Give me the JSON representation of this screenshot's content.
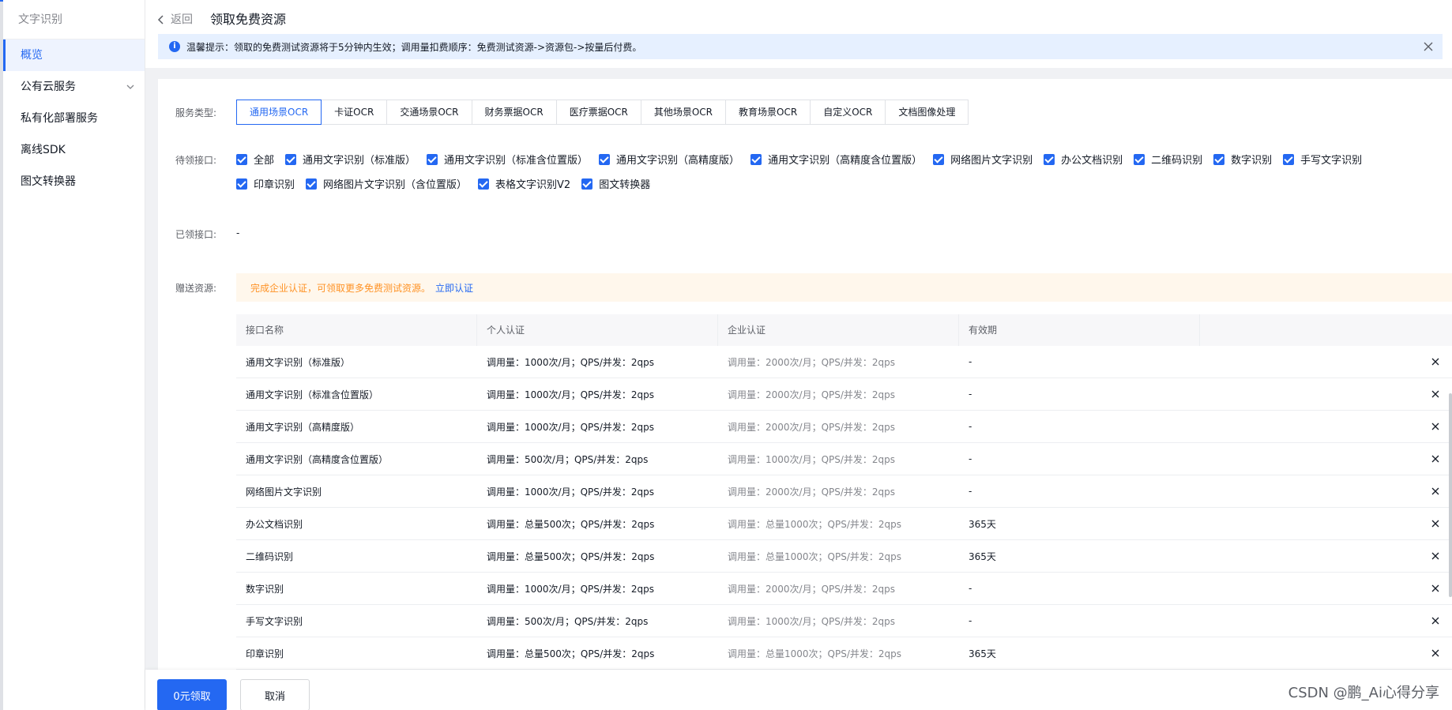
{
  "sidebar": {
    "title": "文字识别",
    "items": [
      {
        "label": "概览",
        "active": true
      },
      {
        "label": "公有云服务",
        "expandable": true
      },
      {
        "label": "私有化部署服务"
      },
      {
        "label": "离线SDK"
      },
      {
        "label": "图文转换器"
      }
    ]
  },
  "header": {
    "back_label": "返回",
    "title": "领取免费资源"
  },
  "notice": {
    "text": "温馨提示：领取的免费测试资源将于5分钟内生效；调用量扣费顺序：免费测试资源->资源包->按量后付费。"
  },
  "form": {
    "service_type_label": "服务类型:",
    "pending_label": "待领接口:",
    "claimed_label": "已领接口:",
    "claimed_value": "-",
    "gift_label": "赠送资源:"
  },
  "tabs": [
    {
      "label": "通用场景OCR",
      "active": true
    },
    {
      "label": "卡证OCR"
    },
    {
      "label": "交通场景OCR"
    },
    {
      "label": "财务票据OCR"
    },
    {
      "label": "医疗票据OCR"
    },
    {
      "label": "其他场景OCR"
    },
    {
      "label": "教育场景OCR"
    },
    {
      "label": "自定义OCR"
    },
    {
      "label": "文档图像处理"
    }
  ],
  "checkboxes": {
    "line1": [
      "全部",
      "通用文字识别（标准版）",
      "通用文字识别（标准含位置版）",
      "通用文字识别（高精度版）",
      "通用文字识别（高精度含位置版）",
      "网络图片文字识别",
      "办公文档识别",
      "二维码识别",
      "数字识别",
      "手写文字识别"
    ],
    "line2": [
      "印章识别",
      "网络图片文字识别（含位置版）",
      "表格文字识别V2",
      "图文转换器"
    ]
  },
  "auth_tip": {
    "text": "完成企业认证，可领取更多免费测试资源。",
    "link": "立即认证"
  },
  "table": {
    "headers": [
      "接口名称",
      "个人认证",
      "企业认证",
      "有效期",
      ""
    ],
    "rows": [
      [
        "通用文字识别（标准版）",
        "调用量：1000次/月；QPS/并发：2qps",
        "调用量：2000次/月；QPS/并发：2qps",
        "-"
      ],
      [
        "通用文字识别（标准含位置版）",
        "调用量：1000次/月；QPS/并发：2qps",
        "调用量：2000次/月；QPS/并发：2qps",
        "-"
      ],
      [
        "通用文字识别（高精度版）",
        "调用量：1000次/月；QPS/并发：2qps",
        "调用量：2000次/月；QPS/并发：2qps",
        "-"
      ],
      [
        "通用文字识别（高精度含位置版）",
        "调用量：500次/月；QPS/并发：2qps",
        "调用量：1000次/月；QPS/并发：2qps",
        "-"
      ],
      [
        "网络图片文字识别",
        "调用量：1000次/月；QPS/并发：2qps",
        "调用量：2000次/月；QPS/并发：2qps",
        "-"
      ],
      [
        "办公文档识别",
        "调用量：总量500次；QPS/并发：2qps",
        "调用量：总量1000次；QPS/并发：2qps",
        "365天"
      ],
      [
        "二维码识别",
        "调用量：总量500次；QPS/并发：2qps",
        "调用量：总量1000次；QPS/并发：2qps",
        "365天"
      ],
      [
        "数字识别",
        "调用量：1000次/月；QPS/并发：2qps",
        "调用量：2000次/月；QPS/并发：2qps",
        "-"
      ],
      [
        "手写文字识别",
        "调用量：500次/月；QPS/并发：2qps",
        "调用量：1000次/月；QPS/并发：2qps",
        "-"
      ],
      [
        "印章识别",
        "调用量：总量500次；QPS/并发：2qps",
        "调用量：总量1000次；QPS/并发：2qps",
        "365天"
      ]
    ]
  },
  "footer": {
    "primary_label": "0元领取",
    "cancel_label": "取消"
  },
  "watermark": "CSDN @鹏_Ai心得分享",
  "colors": {
    "primary": "#2468f2",
    "warning": "#ff9326",
    "notice_bg": "#e6f0ff",
    "tip_bg": "#fff7ec"
  }
}
